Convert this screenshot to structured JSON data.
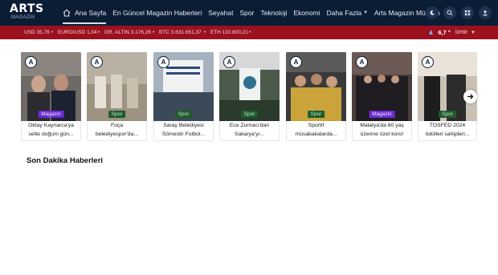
{
  "brand": {
    "logo_text": "ARTS",
    "logo_sub": "MAGAZİN"
  },
  "nav": {
    "items": [
      {
        "label": "Ana Sayfa",
        "active": true
      },
      {
        "label": "En Güncel Magazin Haberleri"
      },
      {
        "label": "Seyahat"
      },
      {
        "label": "Spor"
      },
      {
        "label": "Teknoloji"
      },
      {
        "label": "Ekonomi"
      },
      {
        "label": "Daha Fazla"
      },
      {
        "label": "Arts Magazin Mücevh"
      }
    ]
  },
  "ticker": {
    "items": [
      {
        "label": "USD 35,76"
      },
      {
        "label": "EURO/USD 1,04"
      },
      {
        "label": "GR. ALTIN 3.176,26"
      },
      {
        "label": "BTC 3.631.651,37"
      },
      {
        "label": "ETH 110.800,21"
      }
    ],
    "weather": {
      "temp": "6,7 °",
      "city": "İzmir"
    }
  },
  "cards": [
    {
      "category": "Magazin",
      "title": "Oktay Kaynarca'ya sette doğum gün...",
      "color": "#6c2bd2"
    },
    {
      "category": "Spor",
      "title": "Foça belediyespor'da...",
      "color": "#1f5a2e"
    },
    {
      "category": "Spor",
      "title": "Saray Belediyesi Sömestir Futbol...",
      "color": "#1f5a2e"
    },
    {
      "category": "Spor",
      "title": "Ece Zurnacı'dan Sakarya'yı...",
      "color": "#1f5a2e"
    },
    {
      "category": "Spor",
      "title": "Sportif müsabakalarda...",
      "color": "#1f5a2e"
    },
    {
      "category": "Magazin",
      "title": "Malatya'da 60 yaş üzerine özel koro!",
      "color": "#6c2bd2"
    },
    {
      "category": "Spor",
      "title": "TOSFED 2024 ödülleri sahipleri...",
      "color": "#1f5a2e"
    }
  ],
  "section": {
    "title": "Son Dakika Haberleri"
  }
}
